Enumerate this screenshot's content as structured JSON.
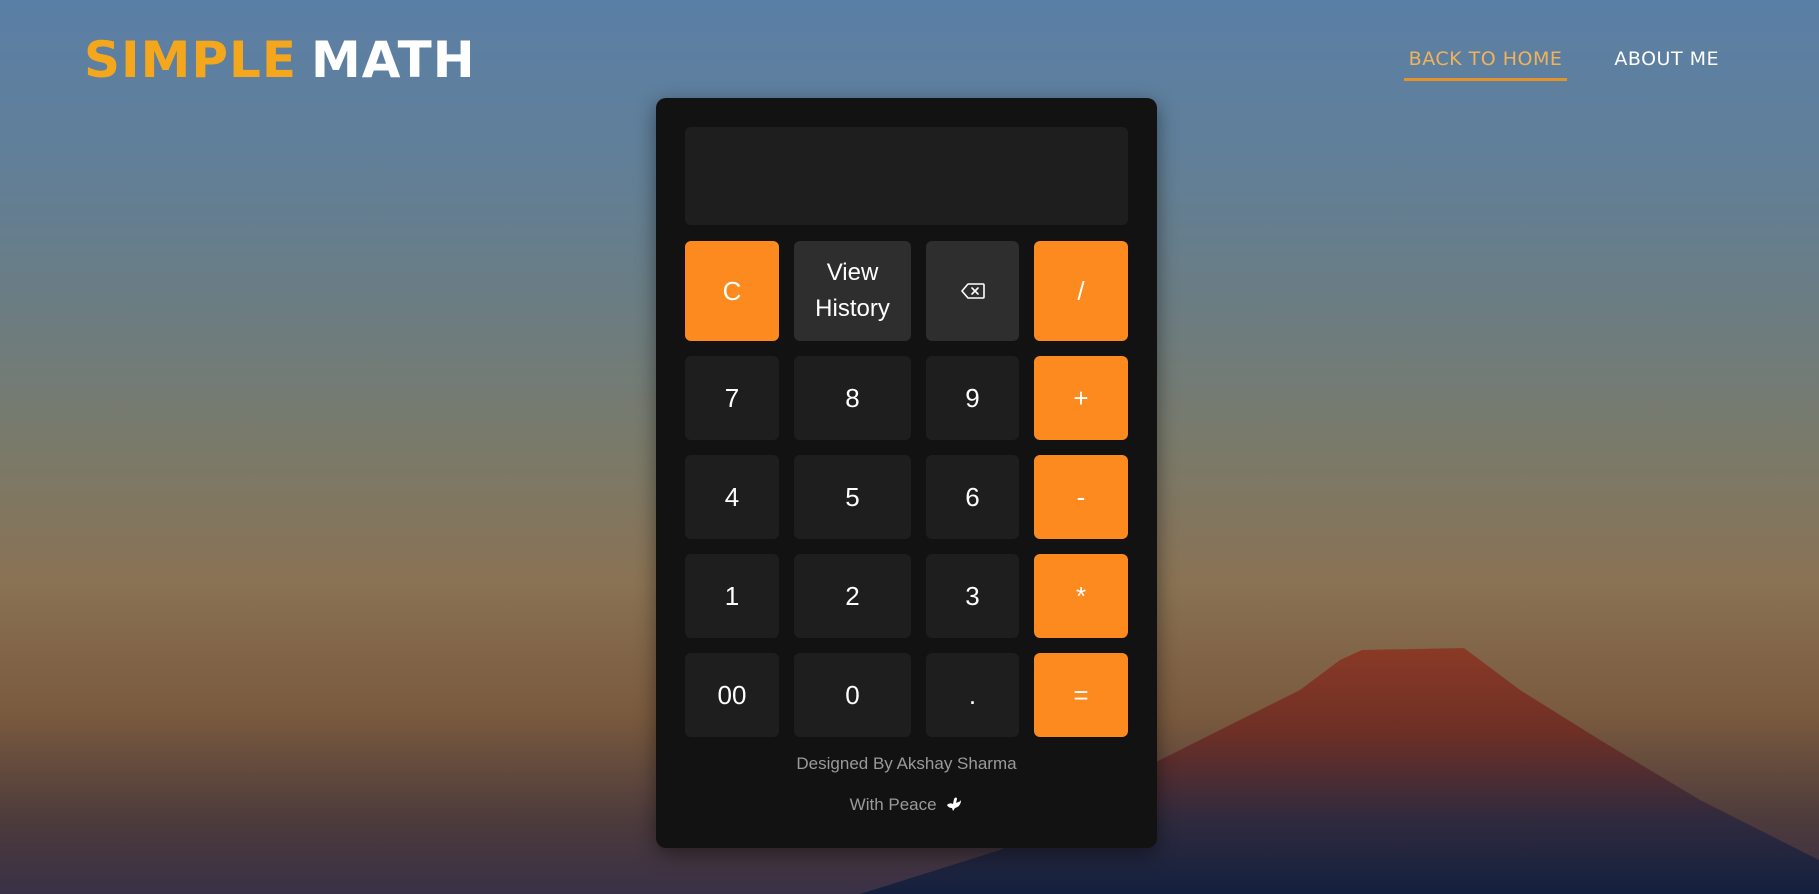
{
  "header": {
    "brand_word_1": "SIMPLE",
    "brand_word_2": "MATH",
    "nav": [
      {
        "label": "BACK TO HOME",
        "active": true
      },
      {
        "label": "ABOUT ME",
        "active": false
      }
    ]
  },
  "calculator": {
    "display_value": "",
    "keys": {
      "clear": "C",
      "history_line1": "View",
      "history_line2": "History",
      "backspace_icon": "backspace-icon",
      "divide": "/",
      "seven": "7",
      "eight": "8",
      "nine": "9",
      "plus": "+",
      "four": "4",
      "five": "5",
      "six": "6",
      "minus": "-",
      "one": "1",
      "two": "2",
      "three": "3",
      "multiply": "*",
      "double_zero": "00",
      "zero": "0",
      "dot": ".",
      "equals": "="
    },
    "credit_line1": "Designed By Akshay Sharma",
    "credit_line2": "With Peace",
    "credit_icon": "dove-icon"
  },
  "colors": {
    "accent": "#fd8a1e",
    "brand_orange": "#f4a71d",
    "panel": "#121212",
    "key": "#1e1e1e"
  }
}
